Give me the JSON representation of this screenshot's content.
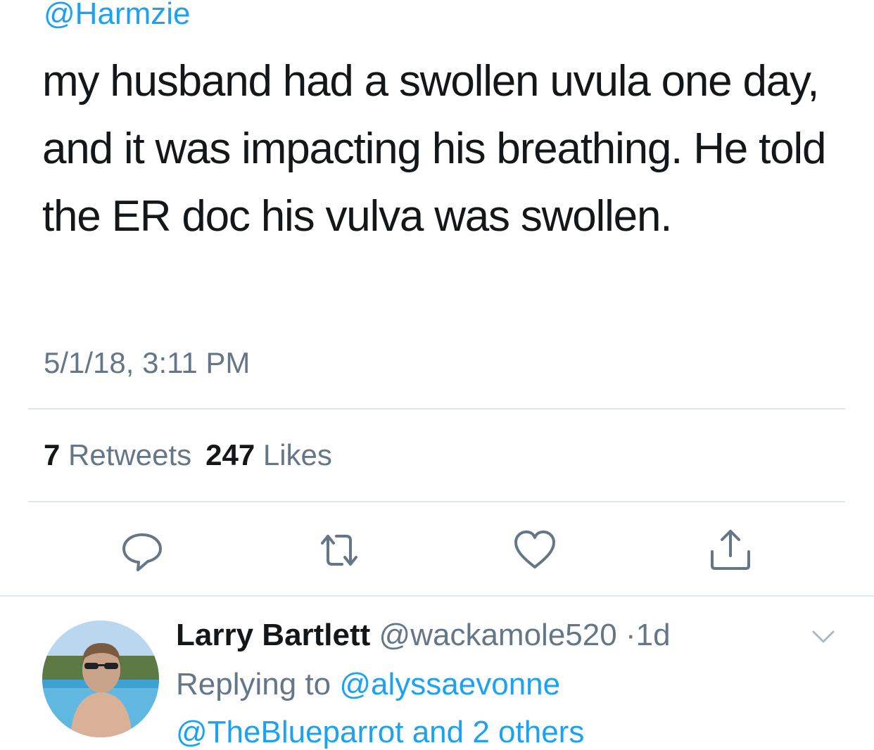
{
  "tweet": {
    "handle": "@Harmzie",
    "text": "my husband had a swollen uvula one day, and it was impacting his breathing. He told the ER doc his vulva was swollen.",
    "timestamp": "5/1/18, 3:11 PM",
    "retweets_count": "7",
    "retweets_label": "Retweets",
    "likes_count": "247",
    "likes_label": "Likes"
  },
  "actions": [
    {
      "name": "reply",
      "icon": "reply-icon"
    },
    {
      "name": "retweet",
      "icon": "retweet-icon"
    },
    {
      "name": "like",
      "icon": "heart-icon"
    },
    {
      "name": "share",
      "icon": "share-icon"
    }
  ],
  "reply": {
    "name": "Larry Bartlett",
    "handle": "@wackamole520",
    "separator": "·",
    "age": "1d",
    "replying_prefix": "Replying to",
    "replying_to": "@alyssaevonne",
    "cut_off_text": "@TheBlueparrot and 2 others"
  },
  "colors": {
    "accent": "#1da1f2",
    "text": "#14171a",
    "secondary": "#657786",
    "divider": "#e1e8ed"
  }
}
